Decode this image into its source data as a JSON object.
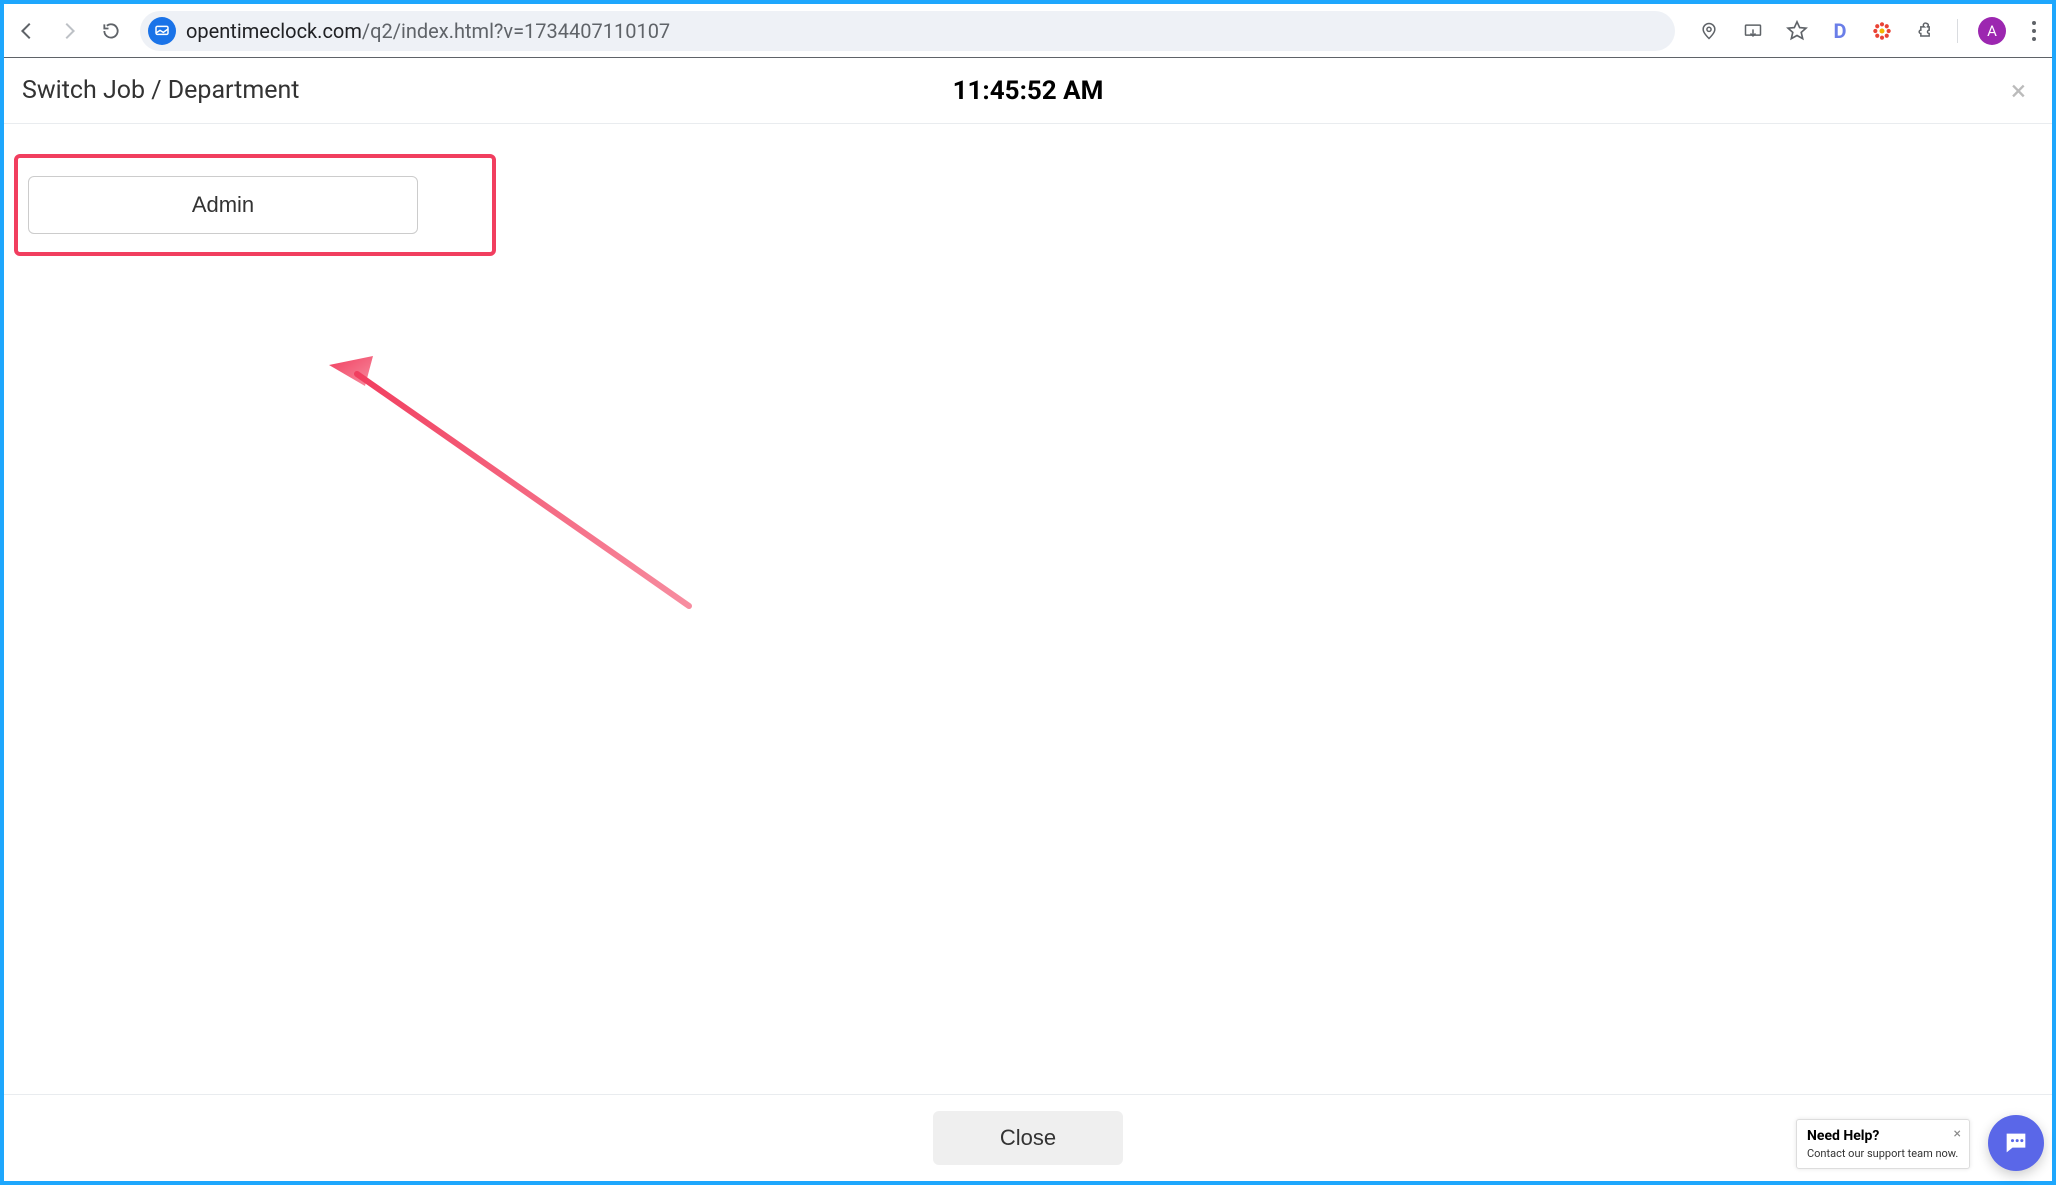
{
  "browser": {
    "url_domain": "opentimeclock.com",
    "url_path": "/q2/index.html?v=1734407110107",
    "avatar_letter": "A",
    "extension_d": "D"
  },
  "dialog": {
    "title": "Switch Job / Department",
    "clock": "11:45:52 AM",
    "job_option": "Admin",
    "close_button_label": "Close"
  },
  "help": {
    "title": "Need Help?",
    "subtitle": "Contact our support team now."
  }
}
